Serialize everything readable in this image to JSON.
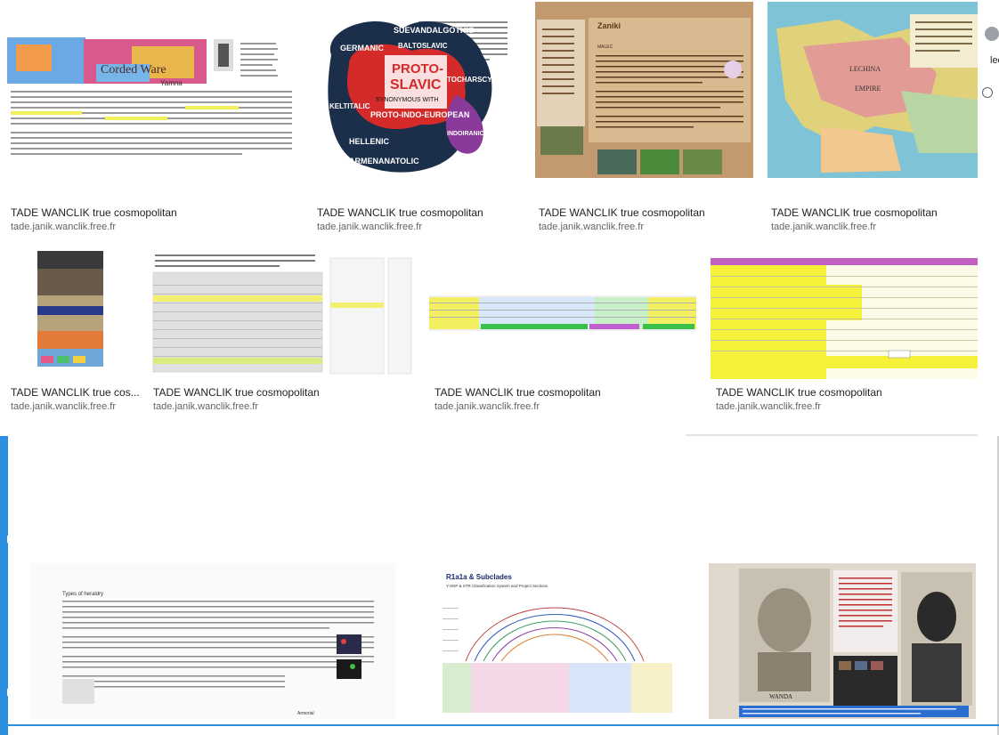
{
  "results": [
    {
      "title": "TADE WANCLIK true cosmopolitan",
      "site": "tade.janik.wanclik.free.fr"
    },
    {
      "title": "TADE WANCLIK true cosmopolitan",
      "site": "tade.janik.wanclik.free.fr"
    },
    {
      "title": "TADE WANCLIK true cosmopolitan",
      "site": "tade.janik.wanclik.free.fr"
    },
    {
      "title": "TADE WANCLIK true cosmopolitan",
      "site": "tade.janik.wanclik.free.fr"
    },
    {
      "title": "TADE WANCLIK true cos...",
      "site": "tade.janik.wanclik.free.fr"
    },
    {
      "title": "TADE WANCLIK true cosmopolitan",
      "site": "tade.janik.wanclik.free.fr"
    },
    {
      "title": "TADE WANCLIK true cosmopolitan",
      "site": "tade.janik.wanclik.free.fr"
    },
    {
      "title": "TADE WANCLIK true cosmopolitan",
      "site": "tade.janik.wanclik.free.fr"
    }
  ],
  "thumb_text": {
    "corded_ware": "Corded Ware",
    "yamna": "Yamna",
    "proto": "PROTO-",
    "slavic": "SLAVIC",
    "synonymous": "SYNONYMOUS WITH",
    "germanic": "GERMANIC",
    "suevand": "SUEVANDALGOTHIC",
    "baltoslavic": "BALTOSLAVIC",
    "kelt": "KELTITALIC",
    "tochar": "TOCHARSCYTHIC",
    "proto_ie": "PROTO-INDO-EUROPEAN",
    "hellenic": "HELLENIC",
    "armen": "ARMENANATOLIC",
    "indoiranic": "INDOIRANIC",
    "zaniki": "Zaniki",
    "malec": "MALEC",
    "lechina": "LECHINA",
    "empire": "EMPIRE",
    "r1a1a": "R1a1a & Subclades",
    "r1a1a_sub": "Y-SNP & STR Classification System and Project Sections",
    "types_heading": "Types of heraldry",
    "weapon_panel": "Armorial",
    "wanda": "WANDA"
  },
  "right_panel": {
    "text": "lec"
  }
}
